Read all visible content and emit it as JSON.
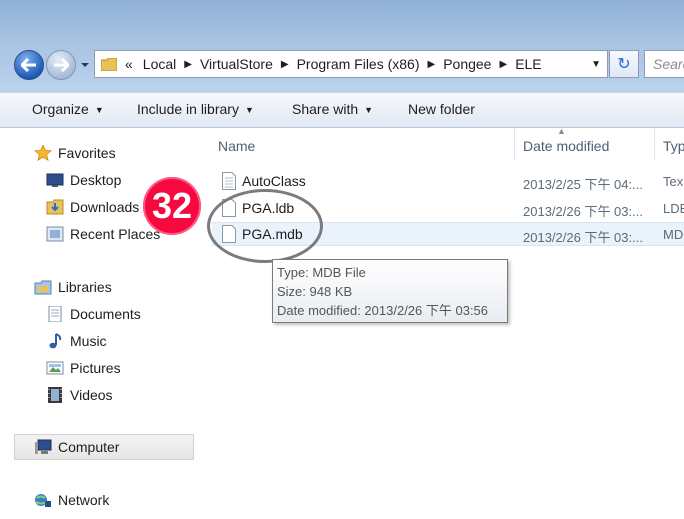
{
  "address": {
    "overflow": "«",
    "crumbs": [
      "Local",
      "VirtualStore",
      "Program Files (x86)",
      "Pongee",
      "ELE"
    ],
    "search_placeholder": "Searc"
  },
  "commands": {
    "organize": "Organize",
    "include": "Include in library",
    "share": "Share with",
    "new_folder": "New folder"
  },
  "nav": {
    "favorites": "Favorites",
    "desktop": "Desktop",
    "downloads": "Downloads",
    "recent": "Recent Places",
    "libraries": "Libraries",
    "documents": "Documents",
    "music": "Music",
    "pictures": "Pictures",
    "videos": "Videos",
    "computer": "Computer",
    "network": "Network"
  },
  "columns": {
    "name": "Name",
    "date": "Date modified",
    "type": "Typ"
  },
  "files": [
    {
      "name": "AutoClass",
      "date": "2013/2/25 下午 04:...",
      "type": "Tex"
    },
    {
      "name": "PGA.ldb",
      "date": "2013/2/26 下午 03:...",
      "type": "LDE"
    },
    {
      "name": "PGA.mdb",
      "date": "2013/2/26 下午 03:...",
      "type": "MD"
    }
  ],
  "tooltip": {
    "type": "Type: MDB File",
    "size": "Size: 948 KB",
    "modified": "Date modified: 2013/2/26 下午 03:56"
  },
  "annotation": {
    "step": "32",
    "color": "#f5093f"
  }
}
